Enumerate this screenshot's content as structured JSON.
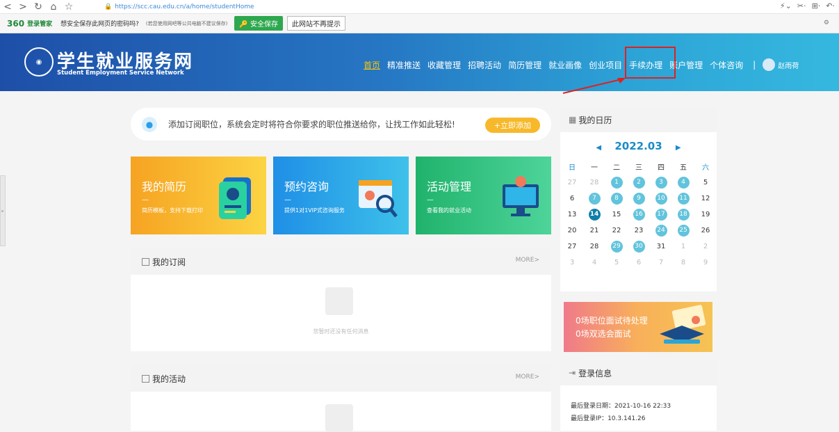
{
  "browser": {
    "url": "https://scc.cau.edu.cn/a/home/studentHome"
  },
  "password_bar": {
    "brand": "360",
    "brand_sub": "登录管家",
    "question": "想安全保存此网页的密码吗?",
    "note": "(若您使用网吧等公共电脑不建议保存)",
    "save_label": "安全保存",
    "dismiss_label": "此网站不再提示"
  },
  "header": {
    "title": "学生就业服务网",
    "subtitle": "Student Employment Service Network",
    "nav": [
      "首页",
      "精准推送",
      "收藏管理",
      "招聘活动",
      "简历管理",
      "就业画像",
      "创业项目",
      "手续办理",
      "账户管理",
      "个体咨询"
    ],
    "separator": "|",
    "user_name": "赵雨荷"
  },
  "subscribe": {
    "text": "添加订阅职位，系统会定时将符合你要求的职位推送给你，让找工作如此轻松!",
    "button": "+立即添加"
  },
  "tiles": [
    {
      "title": "我的简历",
      "dash": "—",
      "desc": "简历模板，支持下载打印"
    },
    {
      "title": "预约咨询",
      "dash": "—",
      "desc": "提供1对1VIP式咨询服务"
    },
    {
      "title": "活动管理",
      "dash": "—",
      "desc": "查看我的就业活动"
    }
  ],
  "subscriptions": {
    "title": "我的订阅",
    "more": "MORE>",
    "empty_text": "您暂时还没有任何消息"
  },
  "activities": {
    "title": "我的活动",
    "more": "MORE>"
  },
  "calendar": {
    "title": "我的日历",
    "prev": "◀",
    "next": "▶",
    "month": "2022.03",
    "weekdays": [
      "日",
      "一",
      "二",
      "三",
      "四",
      "五",
      "六"
    ],
    "days": [
      [
        "27",
        "28",
        "1",
        "2",
        "3",
        "4",
        "5"
      ],
      [
        "6",
        "7",
        "8",
        "9",
        "10",
        "11",
        "12"
      ],
      [
        "13",
        "14",
        "15",
        "16",
        "17",
        "18",
        "19"
      ],
      [
        "20",
        "21",
        "22",
        "23",
        "24",
        "25",
        "26"
      ],
      [
        "27",
        "28",
        "29",
        "30",
        "31",
        "1",
        "2"
      ],
      [
        "3",
        "4",
        "5",
        "6",
        "7",
        "8",
        "9"
      ]
    ]
  },
  "banner": {
    "line1": "0场职位面试待处理",
    "line2": "0场双选会面试"
  },
  "login": {
    "title": "登录信息",
    "date_label": "最后登录日期：2021-10-16 22:33",
    "ip_label": "最后登录IP：10.3.141.26"
  }
}
